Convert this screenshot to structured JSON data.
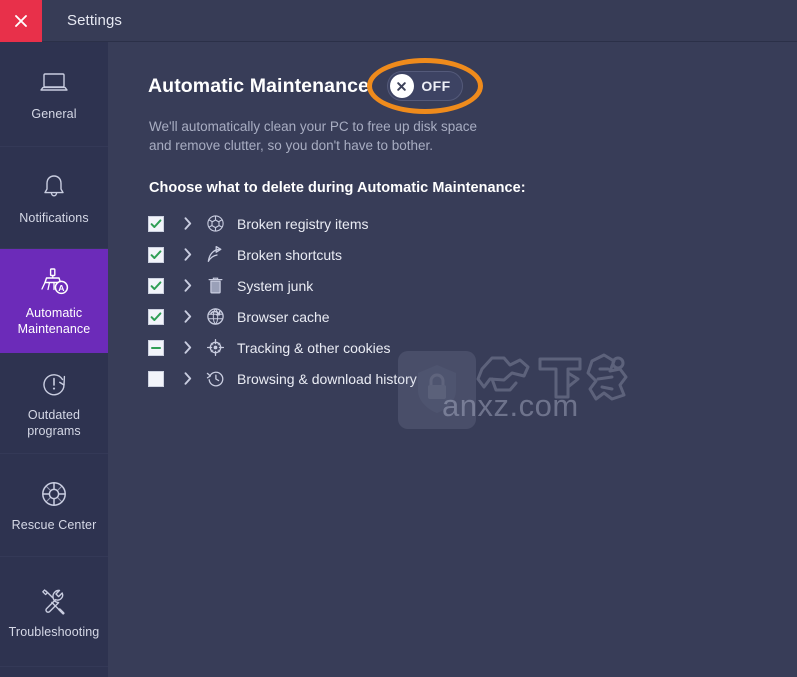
{
  "window": {
    "title": "Settings",
    "close_icon": "close-icon",
    "close_color": "#e8304a",
    "titlebar_color": "#373c56",
    "content_color": "#383d58",
    "sidebar_color": "#2e3350",
    "accent_color": "#6c2bb9",
    "annotation_color": "#ef8b1c"
  },
  "sidebar": {
    "items": [
      {
        "label": "General",
        "icon": "laptop-icon",
        "active": false
      },
      {
        "label": "Notifications",
        "icon": "bell-icon",
        "active": false
      },
      {
        "label": "Automatic Maintenance",
        "icon": "broom-a-icon",
        "active": true
      },
      {
        "label": "Outdated programs",
        "icon": "exclamation-refresh-icon",
        "active": false
      },
      {
        "label": "Rescue Center",
        "icon": "lifebuoy-icon",
        "active": false
      },
      {
        "label": "Troubleshooting",
        "icon": "wrench-screwdriver-icon",
        "active": false
      }
    ]
  },
  "main": {
    "page_title": "Automatic Maintenance",
    "toggle": {
      "state_label": "OFF",
      "checked": false,
      "knob_icon": "x-circle-icon",
      "highlighted": true
    },
    "description": "We'll automatically clean your PC to free up disk space and remove clutter, so you don't have to bother.",
    "section_title": "Choose what to delete during Automatic Maintenance:",
    "items": [
      {
        "label": "Broken registry items",
        "icon": "registry-polyhedron-icon",
        "state": "checked",
        "expand_icon": "chevron-right-icon"
      },
      {
        "label": "Broken shortcuts",
        "icon": "shortcut-arrow-icon",
        "state": "checked",
        "expand_icon": "chevron-right-icon"
      },
      {
        "label": "System junk",
        "icon": "trash-bin-icon",
        "state": "checked",
        "expand_icon": "chevron-right-icon"
      },
      {
        "label": "Browser cache",
        "icon": "browser-globe-icon",
        "state": "checked",
        "expand_icon": "chevron-right-icon"
      },
      {
        "label": "Tracking & other cookies",
        "icon": "crosshair-target-icon",
        "state": "indeterminate",
        "expand_icon": "chevron-right-icon"
      },
      {
        "label": "Browsing & download history",
        "icon": "clock-history-icon",
        "state": "unchecked",
        "expand_icon": "chevron-right-icon"
      }
    ]
  },
  "watermark": {
    "chinese_text": "安下载",
    "domain_text": "anxz.com",
    "badge_icon": "shield-lock-icon"
  }
}
